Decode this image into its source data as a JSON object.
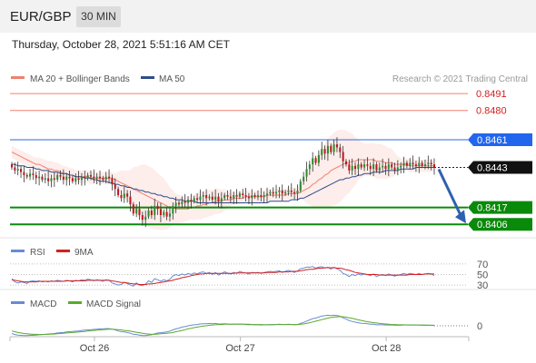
{
  "header": {
    "symbol": "EUR/GBP",
    "timeframe": "30 MIN",
    "datetime": "Thursday, October 28, 2021 5:51:16 AM CET"
  },
  "colors": {
    "ma20_bollinger": "#f08070",
    "ma50": "#2e4e8c",
    "candle_up": "#2e8b2e",
    "candle_down": "#c0181e",
    "resistance": "#f08070",
    "pivot": "#3366dd",
    "support": "#0a8a0a",
    "current_price": "#222222",
    "rsi": "#6a8ad6",
    "rsi_9ma": "#d42020",
    "macd": "#6a8ad6",
    "macd_signal": "#5aaa2a",
    "arrow": "#2e60b0"
  },
  "chart_data": [
    {
      "type": "candlestick",
      "legend": [
        "MA 20 + Bollinger Bands",
        "MA 50"
      ],
      "watermark": "Research © 2021 Trading Central",
      "x_tick_labels": [
        "Oct 26",
        "Oct 27",
        "Oct 28"
      ],
      "ylim": [
        0.8402,
        0.8494
      ],
      "levels": [
        {
          "label": "0.8491",
          "value": 0.8491,
          "kind": "resistance"
        },
        {
          "label": "0.8480",
          "value": 0.848,
          "kind": "resistance"
        },
        {
          "label": "0.8461",
          "value": 0.8461,
          "kind": "pivot"
        },
        {
          "label": "0.8443",
          "value": 0.8443,
          "kind": "current"
        },
        {
          "label": "0.8417",
          "value": 0.8417,
          "kind": "support"
        },
        {
          "label": "0.8406",
          "value": 0.8406,
          "kind": "support"
        }
      ],
      "close": [
        0.8443,
        0.8441,
        0.8442,
        0.844,
        0.8438,
        0.8437,
        0.8439,
        0.8438,
        0.8436,
        0.8437,
        0.8435,
        0.8436,
        0.8434,
        0.8436,
        0.8435,
        0.8438,
        0.8437,
        0.8435,
        0.8437,
        0.8436,
        0.8434,
        0.8436,
        0.8435,
        0.8437,
        0.8436,
        0.8438,
        0.8437,
        0.8436,
        0.8437,
        0.8436,
        0.8435,
        0.8437,
        0.8436,
        0.8432,
        0.8429,
        0.8425,
        0.8423,
        0.8426,
        0.8424,
        0.8419,
        0.8413,
        0.8416,
        0.8412,
        0.8409,
        0.8411,
        0.8415,
        0.8412,
        0.8418,
        0.8416,
        0.8412,
        0.8414,
        0.8411,
        0.8413,
        0.8418,
        0.842,
        0.8419,
        0.8421,
        0.842,
        0.8422,
        0.8421,
        0.8423,
        0.8422,
        0.8424,
        0.8425,
        0.8423,
        0.8424,
        0.8422,
        0.8424,
        0.8421,
        0.8423,
        0.8425,
        0.8424,
        0.8423,
        0.8425,
        0.8424,
        0.8426,
        0.8425,
        0.8424,
        0.8423,
        0.8425,
        0.8424,
        0.8425,
        0.8424,
        0.8425,
        0.8426,
        0.8427,
        0.8426,
        0.8427,
        0.8428,
        0.8426,
        0.8427,
        0.8428,
        0.8427,
        0.8426,
        0.8428,
        0.8434,
        0.8437,
        0.8442,
        0.8445,
        0.8449,
        0.8446,
        0.8451,
        0.8455,
        0.8452,
        0.8457,
        0.8453,
        0.8458,
        0.8456,
        0.8453,
        0.8447,
        0.8445,
        0.8441,
        0.8444,
        0.8442,
        0.8445,
        0.8443,
        0.8445,
        0.8444,
        0.8442,
        0.8445,
        0.8441,
        0.8443,
        0.8444,
        0.8442,
        0.8445,
        0.8443,
        0.8441,
        0.8443,
        0.8444,
        0.8446,
        0.8444,
        0.8446,
        0.8445,
        0.8444,
        0.8446,
        0.8444,
        0.8445,
        0.8446,
        0.8445,
        0.8443
      ],
      "ma20": [
        0.8453,
        0.8452,
        0.8451,
        0.845,
        0.8449,
        0.8448,
        0.8447,
        0.8446,
        0.8445,
        0.8445,
        0.8444,
        0.8443,
        0.8442,
        0.8442,
        0.8441,
        0.8441,
        0.844,
        0.8439,
        0.8439,
        0.8438,
        0.8438,
        0.8437,
        0.8437,
        0.8437,
        0.8437,
        0.8437,
        0.8436,
        0.8436,
        0.8436,
        0.8436,
        0.8436,
        0.8436,
        0.8436,
        0.8436,
        0.8435,
        0.8434,
        0.8433,
        0.8432,
        0.8431,
        0.843,
        0.8429,
        0.8428,
        0.8427,
        0.8426,
        0.8425,
        0.8424,
        0.8423,
        0.8422,
        0.8421,
        0.842,
        0.8419,
        0.8418,
        0.8417,
        0.8417,
        0.8416,
        0.8416,
        0.8416,
        0.8416,
        0.8416,
        0.8417,
        0.8417,
        0.8418,
        0.8418,
        0.8419,
        0.8419,
        0.842,
        0.842,
        0.8421,
        0.8421,
        0.8421,
        0.8422,
        0.8422,
        0.8422,
        0.8423,
        0.8423,
        0.8423,
        0.8423,
        0.8424,
        0.8424,
        0.8424,
        0.8424,
        0.8424,
        0.8424,
        0.8424,
        0.8425,
        0.8425,
        0.8425,
        0.8425,
        0.8425,
        0.8425,
        0.8425,
        0.8426,
        0.8426,
        0.8426,
        0.8426,
        0.8427,
        0.8428,
        0.8429,
        0.843,
        0.8432,
        0.8433,
        0.8435,
        0.8436,
        0.8438,
        0.8439,
        0.8441,
        0.8442,
        0.8443,
        0.8444,
        0.8445,
        0.8446,
        0.8446,
        0.8447,
        0.8447,
        0.8448,
        0.8448,
        0.8448,
        0.8448,
        0.8448,
        0.8448,
        0.8447,
        0.8447,
        0.8447,
        0.8446,
        0.8446,
        0.8446,
        0.8445,
        0.8445,
        0.8445,
        0.8445,
        0.8445,
        0.8444,
        0.8444,
        0.8444,
        0.8444,
        0.8444,
        0.8444,
        0.8444,
        0.8444,
        0.8444
      ],
      "ma50": [
        0.8445,
        0.8445,
        0.8444,
        0.8444,
        0.8444,
        0.8443,
        0.8443,
        0.8443,
        0.8442,
        0.8442,
        0.8441,
        0.8441,
        0.8441,
        0.844,
        0.844,
        0.844,
        0.8439,
        0.8439,
        0.8439,
        0.8438,
        0.8438,
        0.8437,
        0.8437,
        0.8437,
        0.8436,
        0.8436,
        0.8436,
        0.8435,
        0.8435,
        0.8434,
        0.8434,
        0.8434,
        0.8433,
        0.8433,
        0.8432,
        0.8432,
        0.8431,
        0.8431,
        0.843,
        0.843,
        0.8429,
        0.8429,
        0.8428,
        0.8428,
        0.8427,
        0.8427,
        0.8426,
        0.8426,
        0.8425,
        0.8425,
        0.8424,
        0.8424,
        0.8423,
        0.8423,
        0.8422,
        0.8422,
        0.8422,
        0.8421,
        0.8421,
        0.8421,
        0.8421,
        0.842,
        0.842,
        0.842,
        0.842,
        0.842,
        0.842,
        0.842,
        0.842,
        0.842,
        0.842,
        0.842,
        0.842,
        0.842,
        0.842,
        0.842,
        0.842,
        0.842,
        0.842,
        0.842,
        0.842,
        0.842,
        0.842,
        0.842,
        0.842,
        0.8421,
        0.8421,
        0.8421,
        0.8421,
        0.8421,
        0.8421,
        0.8421,
        0.8422,
        0.8422,
        0.8422,
        0.8423,
        0.8423,
        0.8424,
        0.8425,
        0.8426,
        0.8427,
        0.8428,
        0.8429,
        0.843,
        0.8431,
        0.8432,
        0.8433,
        0.8434,
        0.8435,
        0.8435,
        0.8436,
        0.8436,
        0.8437,
        0.8437,
        0.8438,
        0.8438,
        0.8439,
        0.8439,
        0.8439,
        0.844,
        0.844,
        0.844,
        0.844,
        0.8441,
        0.8441,
        0.8441,
        0.8441,
        0.8441,
        0.8442,
        0.8442,
        0.8442,
        0.8442,
        0.8442,
        0.8443,
        0.8443,
        0.8443,
        0.8443,
        0.8443,
        0.8443,
        0.8443
      ]
    },
    {
      "type": "line",
      "legend": [
        "RSI",
        "9MA"
      ],
      "y_tick_labels": [
        "70",
        "50",
        "30"
      ],
      "ylim": [
        25,
        75
      ],
      "series": [
        {
          "name": "RSI",
          "values": [
            42,
            36,
            34,
            36,
            35,
            33,
            37,
            38,
            37,
            38,
            36,
            37,
            36,
            38,
            37,
            39,
            38,
            37,
            39,
            38,
            36,
            39,
            38,
            40,
            39,
            41,
            40,
            38,
            40,
            39,
            37,
            40,
            39,
            34,
            32,
            30,
            31,
            35,
            33,
            30,
            28,
            34,
            30,
            29,
            32,
            38,
            35,
            42,
            40,
            37,
            40,
            38,
            41,
            47,
            50,
            48,
            51,
            49,
            52,
            50,
            53,
            51,
            54,
            55,
            52,
            54,
            50,
            54,
            49,
            52,
            55,
            53,
            51,
            54,
            52,
            56,
            54,
            53,
            51,
            54,
            53,
            54,
            52,
            54,
            55,
            56,
            55,
            56,
            57,
            54,
            56,
            58,
            56,
            54,
            57,
            61,
            62,
            64,
            64,
            65,
            62,
            64,
            65,
            62,
            64,
            60,
            64,
            61,
            58,
            52,
            50,
            46,
            50,
            48,
            51,
            49,
            51,
            50,
            48,
            51,
            46,
            49,
            50,
            48,
            51,
            49,
            47,
            49,
            50,
            52,
            50,
            52,
            51,
            50,
            52,
            50,
            51,
            52,
            51,
            48
          ]
        },
        {
          "name": "9MA",
          "values": [
            40,
            39,
            38,
            37,
            36,
            36,
            36,
            36,
            36,
            37,
            37,
            37,
            37,
            37,
            37,
            37,
            37,
            37,
            38,
            38,
            38,
            38,
            38,
            38,
            38,
            39,
            39,
            39,
            39,
            39,
            39,
            39,
            39,
            38,
            37,
            36,
            35,
            35,
            34,
            33,
            32,
            32,
            31,
            31,
            31,
            32,
            32,
            33,
            34,
            35,
            36,
            37,
            38,
            39,
            41,
            42,
            44,
            45,
            46,
            48,
            49,
            50,
            51,
            51,
            52,
            52,
            52,
            52,
            52,
            52,
            52,
            52,
            52,
            52,
            53,
            53,
            53,
            53,
            53,
            53,
            53,
            53,
            53,
            53,
            54,
            54,
            54,
            54,
            55,
            55,
            55,
            55,
            56,
            56,
            56,
            57,
            58,
            59,
            60,
            60,
            61,
            62,
            62,
            63,
            63,
            63,
            63,
            62,
            62,
            61,
            59,
            58,
            56,
            54,
            53,
            52,
            51,
            50,
            50,
            50,
            50,
            49,
            49,
            49,
            49,
            49,
            49,
            49,
            49,
            49,
            49,
            50,
            50,
            50,
            50,
            50,
            51,
            51,
            51,
            51
          ]
        }
      ]
    },
    {
      "type": "line",
      "legend": [
        "MACD",
        "MACD Signal"
      ],
      "y_tick_labels": [
        "0"
      ],
      "ylim": [
        -0.0006,
        0.0006
      ],
      "series": [
        {
          "name": "MACD",
          "values": [
            -0.0003,
            -0.00034,
            -0.00036,
            -0.00037,
            -0.00038,
            -0.00038,
            -0.00037,
            -0.00037,
            -0.00036,
            -0.00035,
            -0.00034,
            -0.00033,
            -0.00032,
            -0.00031,
            -0.0003,
            -0.00028,
            -0.00027,
            -0.00026,
            -0.00024,
            -0.00023,
            -0.00022,
            -0.00021,
            -0.0002,
            -0.00018,
            -0.00017,
            -0.00016,
            -0.00015,
            -0.00014,
            -0.00013,
            -0.00012,
            -0.00012,
            -0.00011,
            -0.00011,
            -0.00013,
            -0.00016,
            -0.0002,
            -0.00023,
            -0.00024,
            -0.00026,
            -0.00029,
            -0.00033,
            -0.00034,
            -0.00036,
            -0.00038,
            -0.00038,
            -0.00036,
            -0.00035,
            -0.00031,
            -0.00028,
            -0.00027,
            -0.00025,
            -0.00024,
            -0.00021,
            -0.00016,
            -0.00012,
            -9e-05,
            -5e-05,
            -3e-05,
            0.0,
            2e-05,
            4e-05,
            5e-05,
            7e-05,
            8e-05,
            8e-05,
            9e-05,
            8e-05,
            9e-05,
            7e-05,
            7e-05,
            8e-05,
            7e-05,
            6e-05,
            7e-05,
            6e-05,
            7e-05,
            6e-05,
            5e-05,
            4e-05,
            5e-05,
            4e-05,
            4e-05,
            3e-05,
            4e-05,
            4e-05,
            5e-05,
            5e-05,
            5e-05,
            6e-05,
            5e-05,
            5e-05,
            6e-05,
            5e-05,
            4e-05,
            5e-05,
            9e-05,
            0.00013,
            0.00018,
            0.00023,
            0.00028,
            0.0003,
            0.00034,
            0.00038,
            0.00039,
            0.00041,
            0.0004,
            0.00041,
            0.0004,
            0.00037,
            0.00031,
            0.00026,
            0.0002,
            0.00017,
            0.00014,
            0.00012,
            0.0001,
            9e-05,
            8e-05,
            6e-05,
            6e-05,
            4e-05,
            4e-05,
            4e-05,
            3e-05,
            3e-05,
            3e-05,
            2e-05,
            2e-05,
            2e-05,
            3e-05,
            3e-05,
            3e-05,
            3e-05,
            3e-05,
            3e-05,
            2e-05,
            2e-05,
            2e-05,
            2e-05,
            1e-05
          ]
        },
        {
          "name": "MACD Signal",
          "values": [
            -0.0002,
            -0.00023,
            -0.00026,
            -0.00028,
            -0.0003,
            -0.00031,
            -0.00032,
            -0.00033,
            -0.00033,
            -0.00034,
            -0.00034,
            -0.00033,
            -0.00033,
            -0.00032,
            -0.00032,
            -0.00031,
            -0.0003,
            -0.00029,
            -0.00028,
            -0.00027,
            -0.00026,
            -0.00025,
            -0.00024,
            -0.00023,
            -0.00022,
            -0.0002,
            -0.00019,
            -0.00018,
            -0.00017,
            -0.00016,
            -0.00015,
            -0.00014,
            -0.00013,
            -0.00013,
            -0.00014,
            -0.00015,
            -0.00016,
            -0.00018,
            -0.00019,
            -0.00021,
            -0.00023,
            -0.00025,
            -0.00027,
            -0.00029,
            -0.00031,
            -0.00032,
            -0.00033,
            -0.00033,
            -0.00032,
            -0.00031,
            -0.0003,
            -0.00029,
            -0.00028,
            -0.00026,
            -0.00023,
            -0.00021,
            -0.00018,
            -0.00015,
            -0.00012,
            -0.0001,
            -7e-05,
            -5e-05,
            -3e-05,
            -1e-05,
            0.0,
            2e-05,
            3e-05,
            4e-05,
            5e-05,
            5e-05,
            6e-05,
            6e-05,
            6e-05,
            6e-05,
            6e-05,
            6e-05,
            6e-05,
            6e-05,
            6e-05,
            5e-05,
            5e-05,
            5e-05,
            5e-05,
            4e-05,
            4e-05,
            4e-05,
            4e-05,
            5e-05,
            5e-05,
            5e-05,
            5e-05,
            5e-05,
            5e-05,
            5e-05,
            5e-05,
            6e-05,
            7e-05,
            9e-05,
            0.00012,
            0.00015,
            0.00018,
            0.00021,
            0.00024,
            0.00027,
            0.0003,
            0.00032,
            0.00034,
            0.00035,
            0.00036,
            0.00035,
            0.00034,
            0.00031,
            0.00029,
            0.00026,
            0.00023,
            0.00021,
            0.00018,
            0.00016,
            0.00014,
            0.00012,
            0.00011,
            9e-05,
            8e-05,
            7e-05,
            6e-05,
            5e-05,
            5e-05,
            4e-05,
            4e-05,
            4e-05,
            3e-05,
            3e-05,
            3e-05,
            3e-05,
            3e-05,
            3e-05,
            3e-05,
            2e-05,
            2e-05,
            2e-05
          ]
        }
      ]
    }
  ]
}
